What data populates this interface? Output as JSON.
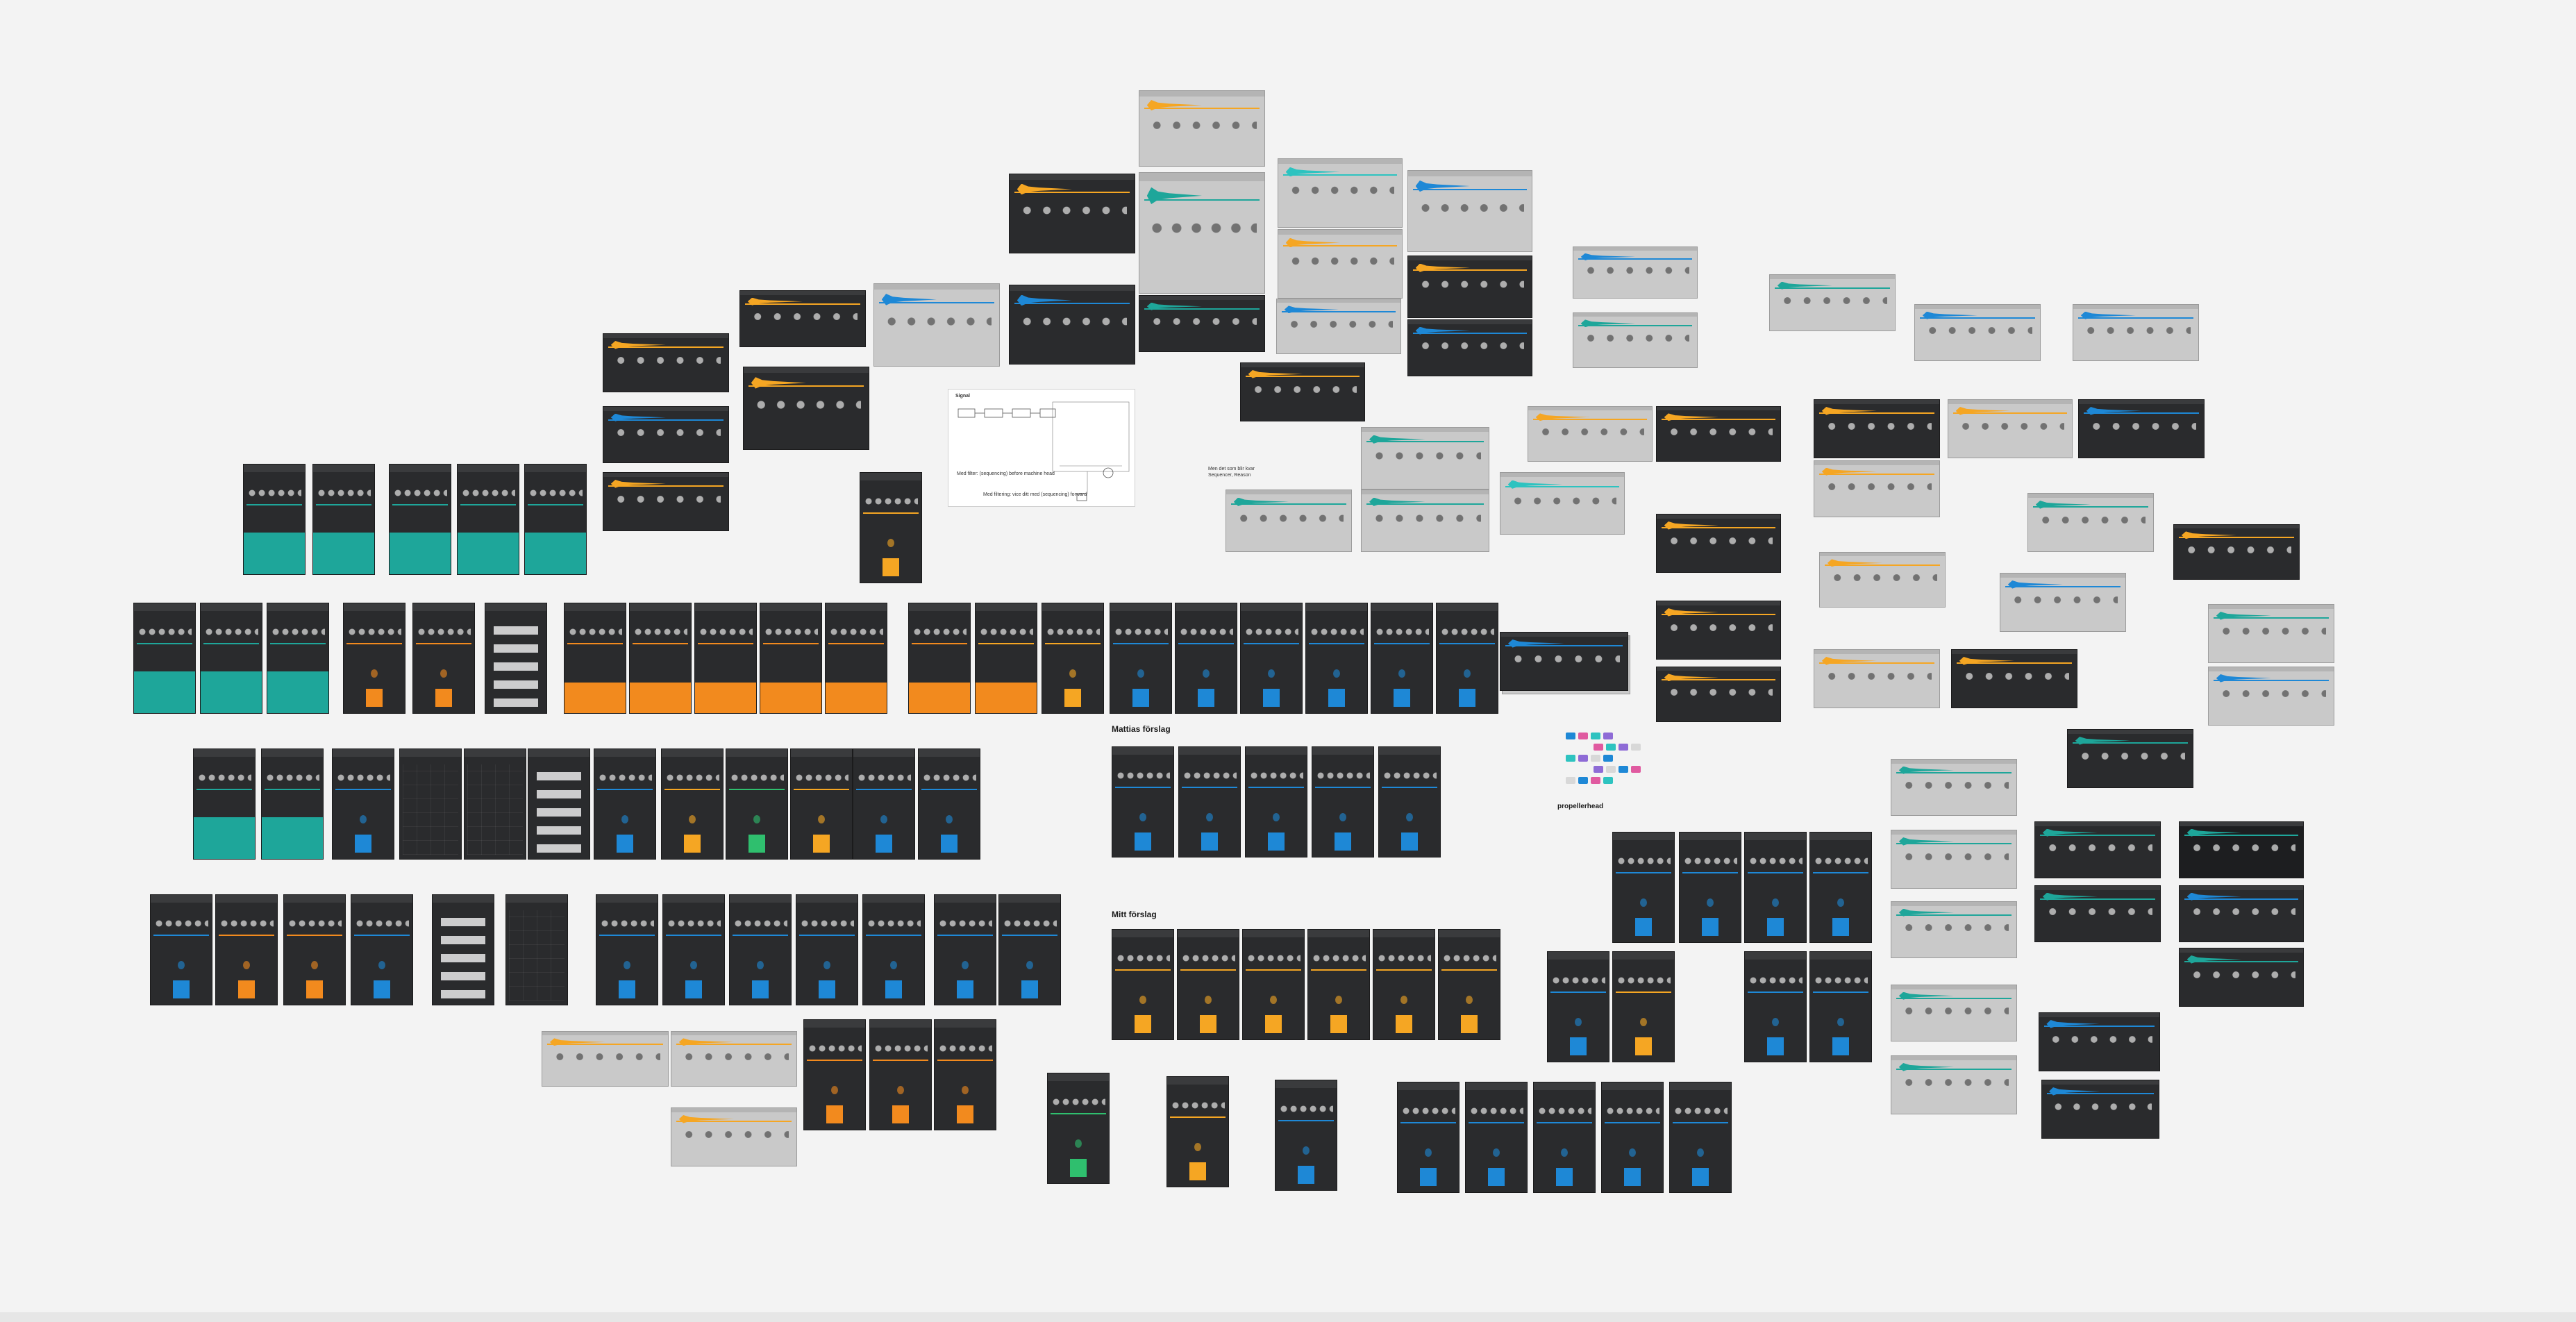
{
  "canvas": {
    "background": "#f3f3f3",
    "labels": {
      "mattias": "Mattias förslag",
      "mitt": "Mitt förslag",
      "propellerhead": "propellerhead"
    },
    "diagram": {
      "heading": "Signal",
      "note_top": "Med filter: (sequencing) before machine head",
      "note_bottom": "Med filtering: vice ditt med (sequencing) forward"
    },
    "small_note": {
      "line1": "Men det som blir kvar",
      "line2": "Sequencer, Reason"
    }
  },
  "colors": {
    "teal": "#1ea69a",
    "orange": "#f28a1e",
    "amber": "#f5a623",
    "blue": "#1e88d6",
    "cyan": "#2dc3c0",
    "green": "#2fbf6e",
    "panel_dark": "#2a2b2d",
    "panel_grey": "#c9c9c9"
  }
}
